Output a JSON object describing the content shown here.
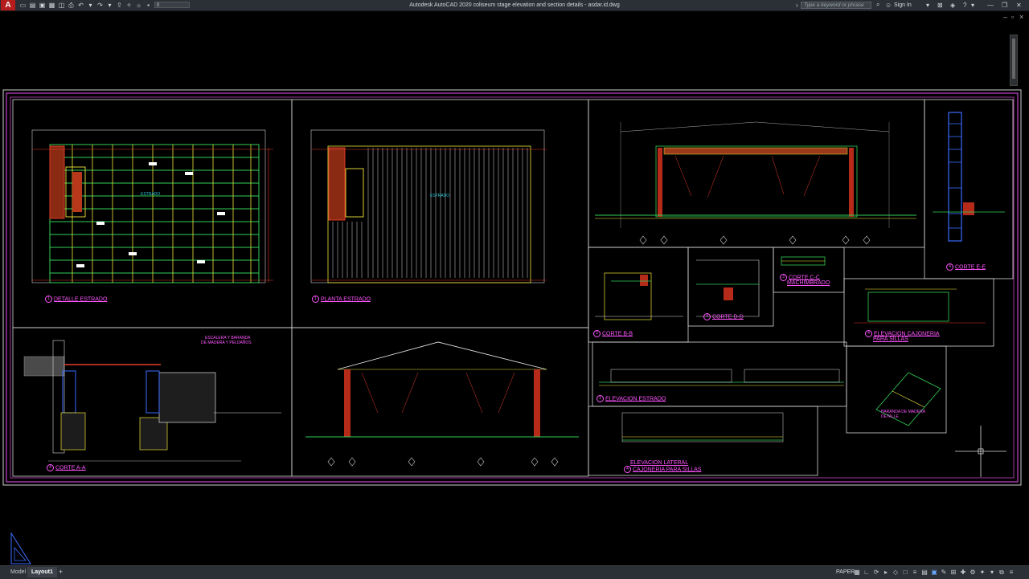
{
  "app": {
    "logo": "A",
    "title": "Autodesk AutoCAD 2020    coliseum stage elevation and section details - asdar.id.dwg",
    "workspace_value": "0"
  },
  "search": {
    "placeholder": "Type a keyword or phrase"
  },
  "account": {
    "signin_label": "Sign In"
  },
  "layout_tabs": {
    "model": "Model",
    "layout1": "Layout1",
    "add": "+"
  },
  "status": {
    "paper": "PAPER"
  },
  "icons": {
    "qat": [
      "new-icon",
      "open-icon",
      "save-icon",
      "saveas-icon",
      "open-web-icon",
      "plot-icon",
      "undo-icon",
      "redo-icon",
      "share-icon",
      "lightbulb-icon",
      "sun-icon",
      "layer-icon"
    ],
    "status": [
      "grid-icon",
      "snap-icon",
      "ortho-icon",
      "polar-icon",
      "isodraft-icon",
      "osnap-icon",
      "lineweight-icon",
      "transparency-icon",
      "selection-cycling-icon",
      "annotation-scale-icon",
      "workspace-icon",
      "quick-props-icon",
      "lock-ui-icon",
      "isolate-icon",
      "hardware-accel-icon",
      "clean-screen-icon",
      "customize-icon"
    ]
  },
  "colors": {
    "label": "#ff55ff",
    "frame": "#c844c8",
    "green": "#31d158",
    "red": "#e03a2a",
    "yellow": "#f0e53a",
    "cyan": "#28c8d8",
    "white": "#e8e8e8"
  },
  "drawing": {
    "labels": [
      {
        "num": "1",
        "text": "DETALLE ESTRADO"
      },
      {
        "num": "1",
        "text": "PLANTA ESTRADO"
      },
      {
        "num": "4",
        "text": "CORTE E-E"
      },
      {
        "num": "3",
        "text": "CORTE C-C"
      },
      {
        "num": "",
        "text": "MACHIMBRADO"
      },
      {
        "num": "3",
        "text": "CORTE B-B"
      },
      {
        "num": "4",
        "text": "CORTE D-D"
      },
      {
        "num": "4",
        "text": "ELEVACION CAJONERIA"
      },
      {
        "num": "",
        "text": "PARA SILLAS"
      },
      {
        "num": "1",
        "text": "ELEVACION ESTRADO"
      },
      {
        "num": "4",
        "text": "CORTE A-A"
      },
      {
        "num": "",
        "text": "ELEVACION LATERAL"
      },
      {
        "num": "4",
        "text": "CAJONERIA PARA SILLAS"
      }
    ],
    "notes": {
      "estrado": "ESTRADO",
      "escalera": "ESCALERA Y BARANDA",
      "escalera2": "DE MADERA Y PELDAÑOS",
      "barandas": "BARANDA DE MADERA",
      "barandas2": "DETALLE"
    }
  }
}
